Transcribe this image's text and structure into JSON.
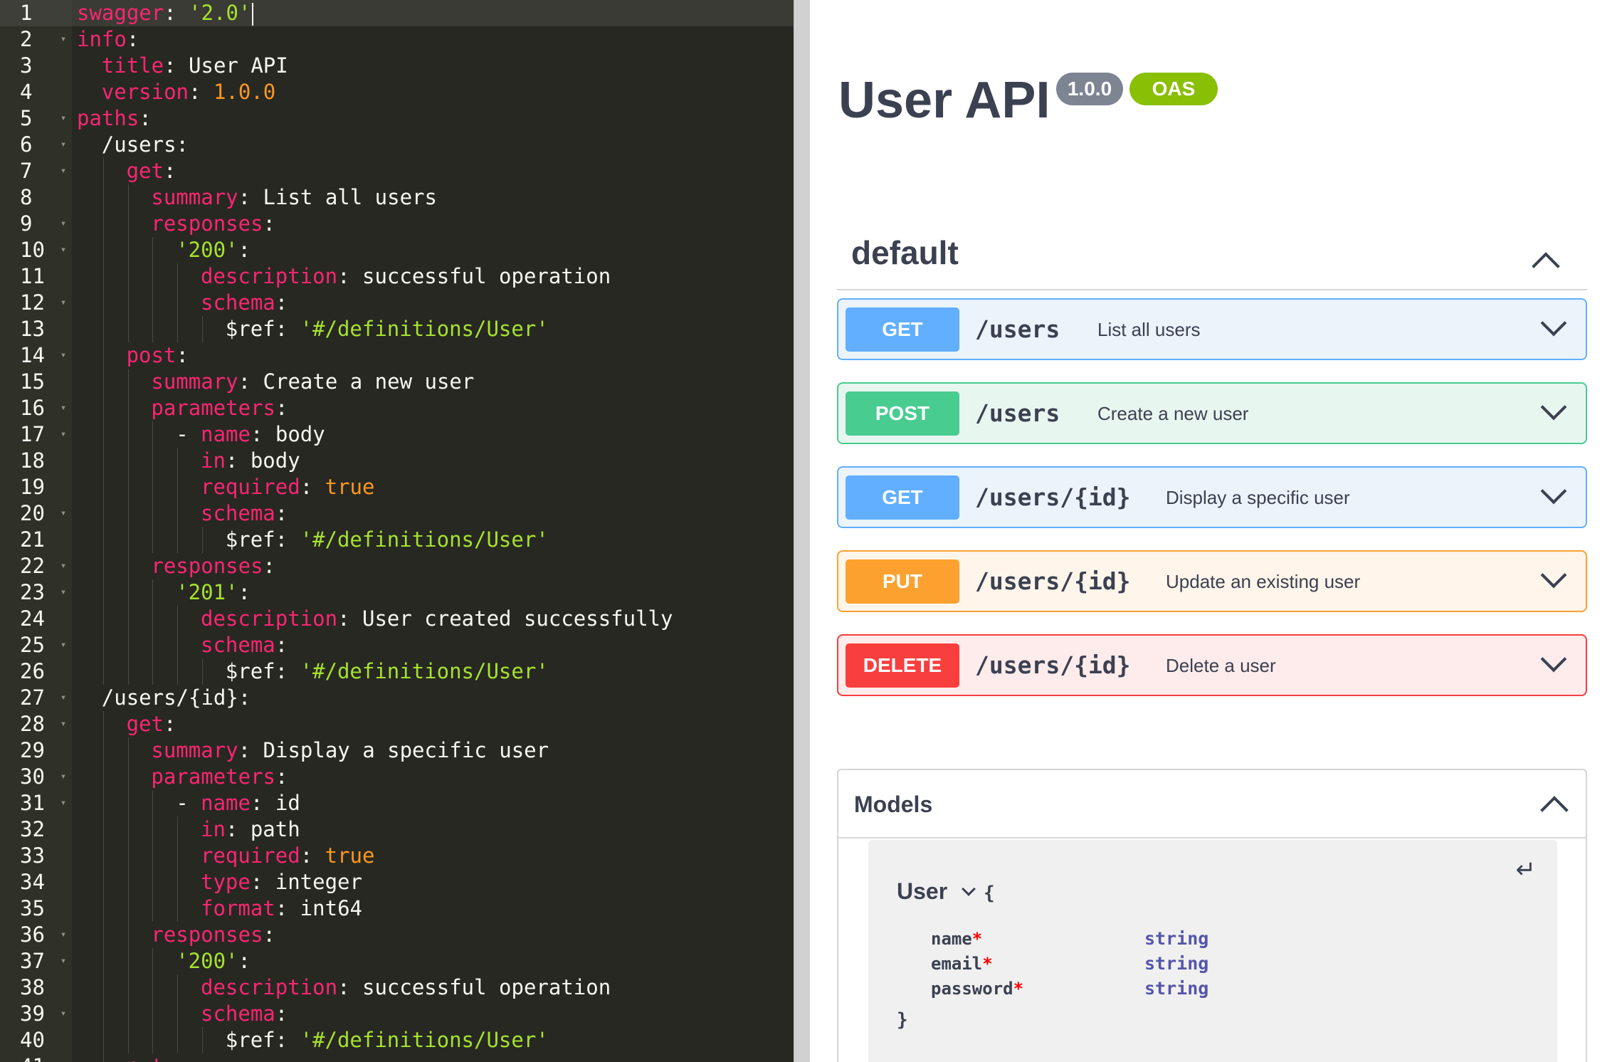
{
  "editor": {
    "lines": [
      {
        "n": "1",
        "fold": false,
        "indent": 0,
        "parts": [
          [
            "k",
            "swagger"
          ],
          [
            "v",
            ": "
          ],
          [
            "s",
            "'2.0'"
          ]
        ],
        "cursor": true
      },
      {
        "n": "2",
        "fold": true,
        "indent": 0,
        "parts": [
          [
            "k",
            "info"
          ],
          [
            "v",
            ":"
          ]
        ]
      },
      {
        "n": "3",
        "fold": false,
        "indent": 1,
        "parts": [
          [
            "k",
            "title"
          ],
          [
            "v",
            ": User API"
          ]
        ]
      },
      {
        "n": "4",
        "fold": false,
        "indent": 1,
        "parts": [
          [
            "k",
            "version"
          ],
          [
            "v",
            ": "
          ],
          [
            "n",
            "1.0.0"
          ]
        ]
      },
      {
        "n": "5",
        "fold": true,
        "indent": 0,
        "parts": [
          [
            "k",
            "paths"
          ],
          [
            "v",
            ":"
          ]
        ]
      },
      {
        "n": "6",
        "fold": true,
        "indent": 1,
        "parts": [
          [
            "v",
            "/users:"
          ]
        ]
      },
      {
        "n": "7",
        "fold": true,
        "indent": 2,
        "parts": [
          [
            "k",
            "get"
          ],
          [
            "v",
            ":"
          ]
        ]
      },
      {
        "n": "8",
        "fold": false,
        "indent": 3,
        "parts": [
          [
            "k",
            "summary"
          ],
          [
            "v",
            ": List all users"
          ]
        ]
      },
      {
        "n": "9",
        "fold": true,
        "indent": 3,
        "parts": [
          [
            "k",
            "responses"
          ],
          [
            "v",
            ":"
          ]
        ]
      },
      {
        "n": "10",
        "fold": true,
        "indent": 4,
        "parts": [
          [
            "s",
            "'200'"
          ],
          [
            "v",
            ":"
          ]
        ]
      },
      {
        "n": "11",
        "fold": false,
        "indent": 5,
        "parts": [
          [
            "k",
            "description"
          ],
          [
            "v",
            ": successful operation"
          ]
        ]
      },
      {
        "n": "12",
        "fold": true,
        "indent": 5,
        "parts": [
          [
            "k",
            "schema"
          ],
          [
            "v",
            ":"
          ]
        ]
      },
      {
        "n": "13",
        "fold": false,
        "indent": 6,
        "parts": [
          [
            "v",
            "$ref: "
          ],
          [
            "s",
            "'#/definitions/User'"
          ]
        ]
      },
      {
        "n": "14",
        "fold": true,
        "indent": 2,
        "parts": [
          [
            "k",
            "post"
          ],
          [
            "v",
            ":"
          ]
        ]
      },
      {
        "n": "15",
        "fold": false,
        "indent": 3,
        "parts": [
          [
            "k",
            "summary"
          ],
          [
            "v",
            ": Create a new user"
          ]
        ]
      },
      {
        "n": "16",
        "fold": true,
        "indent": 3,
        "parts": [
          [
            "k",
            "parameters"
          ],
          [
            "v",
            ":"
          ]
        ]
      },
      {
        "n": "17",
        "fold": true,
        "indent": 4,
        "parts": [
          [
            "v",
            "- "
          ],
          [
            "k",
            "name"
          ],
          [
            "v",
            ": body"
          ]
        ]
      },
      {
        "n": "18",
        "fold": false,
        "indent": 5,
        "parts": [
          [
            "k",
            "in"
          ],
          [
            "v",
            ": body"
          ]
        ]
      },
      {
        "n": "19",
        "fold": false,
        "indent": 5,
        "parts": [
          [
            "k",
            "required"
          ],
          [
            "v",
            ": "
          ],
          [
            "n",
            "true"
          ]
        ]
      },
      {
        "n": "20",
        "fold": true,
        "indent": 5,
        "parts": [
          [
            "k",
            "schema"
          ],
          [
            "v",
            ":"
          ]
        ]
      },
      {
        "n": "21",
        "fold": false,
        "indent": 6,
        "parts": [
          [
            "v",
            "$ref: "
          ],
          [
            "s",
            "'#/definitions/User'"
          ]
        ]
      },
      {
        "n": "22",
        "fold": true,
        "indent": 3,
        "parts": [
          [
            "k",
            "responses"
          ],
          [
            "v",
            ":"
          ]
        ]
      },
      {
        "n": "23",
        "fold": true,
        "indent": 4,
        "parts": [
          [
            "s",
            "'201'"
          ],
          [
            "v",
            ":"
          ]
        ]
      },
      {
        "n": "24",
        "fold": false,
        "indent": 5,
        "parts": [
          [
            "k",
            "description"
          ],
          [
            "v",
            ": User created successfully"
          ]
        ]
      },
      {
        "n": "25",
        "fold": true,
        "indent": 5,
        "parts": [
          [
            "k",
            "schema"
          ],
          [
            "v",
            ":"
          ]
        ]
      },
      {
        "n": "26",
        "fold": false,
        "indent": 6,
        "parts": [
          [
            "v",
            "$ref: "
          ],
          [
            "s",
            "'#/definitions/User'"
          ]
        ]
      },
      {
        "n": "27",
        "fold": true,
        "indent": 1,
        "parts": [
          [
            "v",
            "/users/{id}:"
          ]
        ]
      },
      {
        "n": "28",
        "fold": true,
        "indent": 2,
        "parts": [
          [
            "k",
            "get"
          ],
          [
            "v",
            ":"
          ]
        ]
      },
      {
        "n": "29",
        "fold": false,
        "indent": 3,
        "parts": [
          [
            "k",
            "summary"
          ],
          [
            "v",
            ": Display a specific user"
          ]
        ]
      },
      {
        "n": "30",
        "fold": true,
        "indent": 3,
        "parts": [
          [
            "k",
            "parameters"
          ],
          [
            "v",
            ":"
          ]
        ]
      },
      {
        "n": "31",
        "fold": true,
        "indent": 4,
        "parts": [
          [
            "v",
            "- "
          ],
          [
            "k",
            "name"
          ],
          [
            "v",
            ": id"
          ]
        ]
      },
      {
        "n": "32",
        "fold": false,
        "indent": 5,
        "parts": [
          [
            "k",
            "in"
          ],
          [
            "v",
            ": path"
          ]
        ]
      },
      {
        "n": "33",
        "fold": false,
        "indent": 5,
        "parts": [
          [
            "k",
            "required"
          ],
          [
            "v",
            ": "
          ],
          [
            "n",
            "true"
          ]
        ]
      },
      {
        "n": "34",
        "fold": false,
        "indent": 5,
        "parts": [
          [
            "k",
            "type"
          ],
          [
            "v",
            ": integer"
          ]
        ]
      },
      {
        "n": "35",
        "fold": false,
        "indent": 5,
        "parts": [
          [
            "k",
            "format"
          ],
          [
            "v",
            ": int64"
          ]
        ]
      },
      {
        "n": "36",
        "fold": true,
        "indent": 3,
        "parts": [
          [
            "k",
            "responses"
          ],
          [
            "v",
            ":"
          ]
        ]
      },
      {
        "n": "37",
        "fold": true,
        "indent": 4,
        "parts": [
          [
            "s",
            "'200'"
          ],
          [
            "v",
            ":"
          ]
        ]
      },
      {
        "n": "38",
        "fold": false,
        "indent": 5,
        "parts": [
          [
            "k",
            "description"
          ],
          [
            "v",
            ": successful operation"
          ]
        ]
      },
      {
        "n": "39",
        "fold": true,
        "indent": 5,
        "parts": [
          [
            "k",
            "schema"
          ],
          [
            "v",
            ":"
          ]
        ]
      },
      {
        "n": "40",
        "fold": false,
        "indent": 6,
        "parts": [
          [
            "v",
            "$ref: "
          ],
          [
            "s",
            "'#/definitions/User'"
          ]
        ]
      },
      {
        "n": "41",
        "fold": true,
        "indent": 2,
        "parts": [
          [
            "k",
            "put"
          ],
          [
            "v",
            ":"
          ]
        ]
      }
    ]
  },
  "ui": {
    "title": "User API",
    "version_badge": "1.0.0",
    "oas_badge": "OAS 2.0",
    "section": {
      "title": "default",
      "icon": "chevron-up-icon"
    },
    "operations": [
      {
        "method": "GET",
        "path": "/users",
        "summary": "List all users",
        "kind": "get"
      },
      {
        "method": "POST",
        "path": "/users",
        "summary": "Create a new user",
        "kind": "post"
      },
      {
        "method": "GET",
        "path": "/users/{id}",
        "summary": "Display a specific user",
        "kind": "get"
      },
      {
        "method": "PUT",
        "path": "/users/{id}",
        "summary": "Update an existing user",
        "kind": "put"
      },
      {
        "method": "DELETE",
        "path": "/users/{id}",
        "summary": "Delete a user",
        "kind": "delete"
      }
    ],
    "models": {
      "title": "Models",
      "collapse_glyph": "↵",
      "model_name": "User",
      "brace_open": "{",
      "brace_close": "}",
      "required_marker": "*",
      "properties": [
        {
          "name": "name",
          "type": "string"
        },
        {
          "name": "email",
          "type": "string"
        },
        {
          "name": "password",
          "type": "string"
        }
      ]
    }
  },
  "colors": {
    "get": "#61affe",
    "post": "#49cc90",
    "put": "#fca130",
    "delete": "#f93e3e",
    "editor_bg": "#272822"
  }
}
